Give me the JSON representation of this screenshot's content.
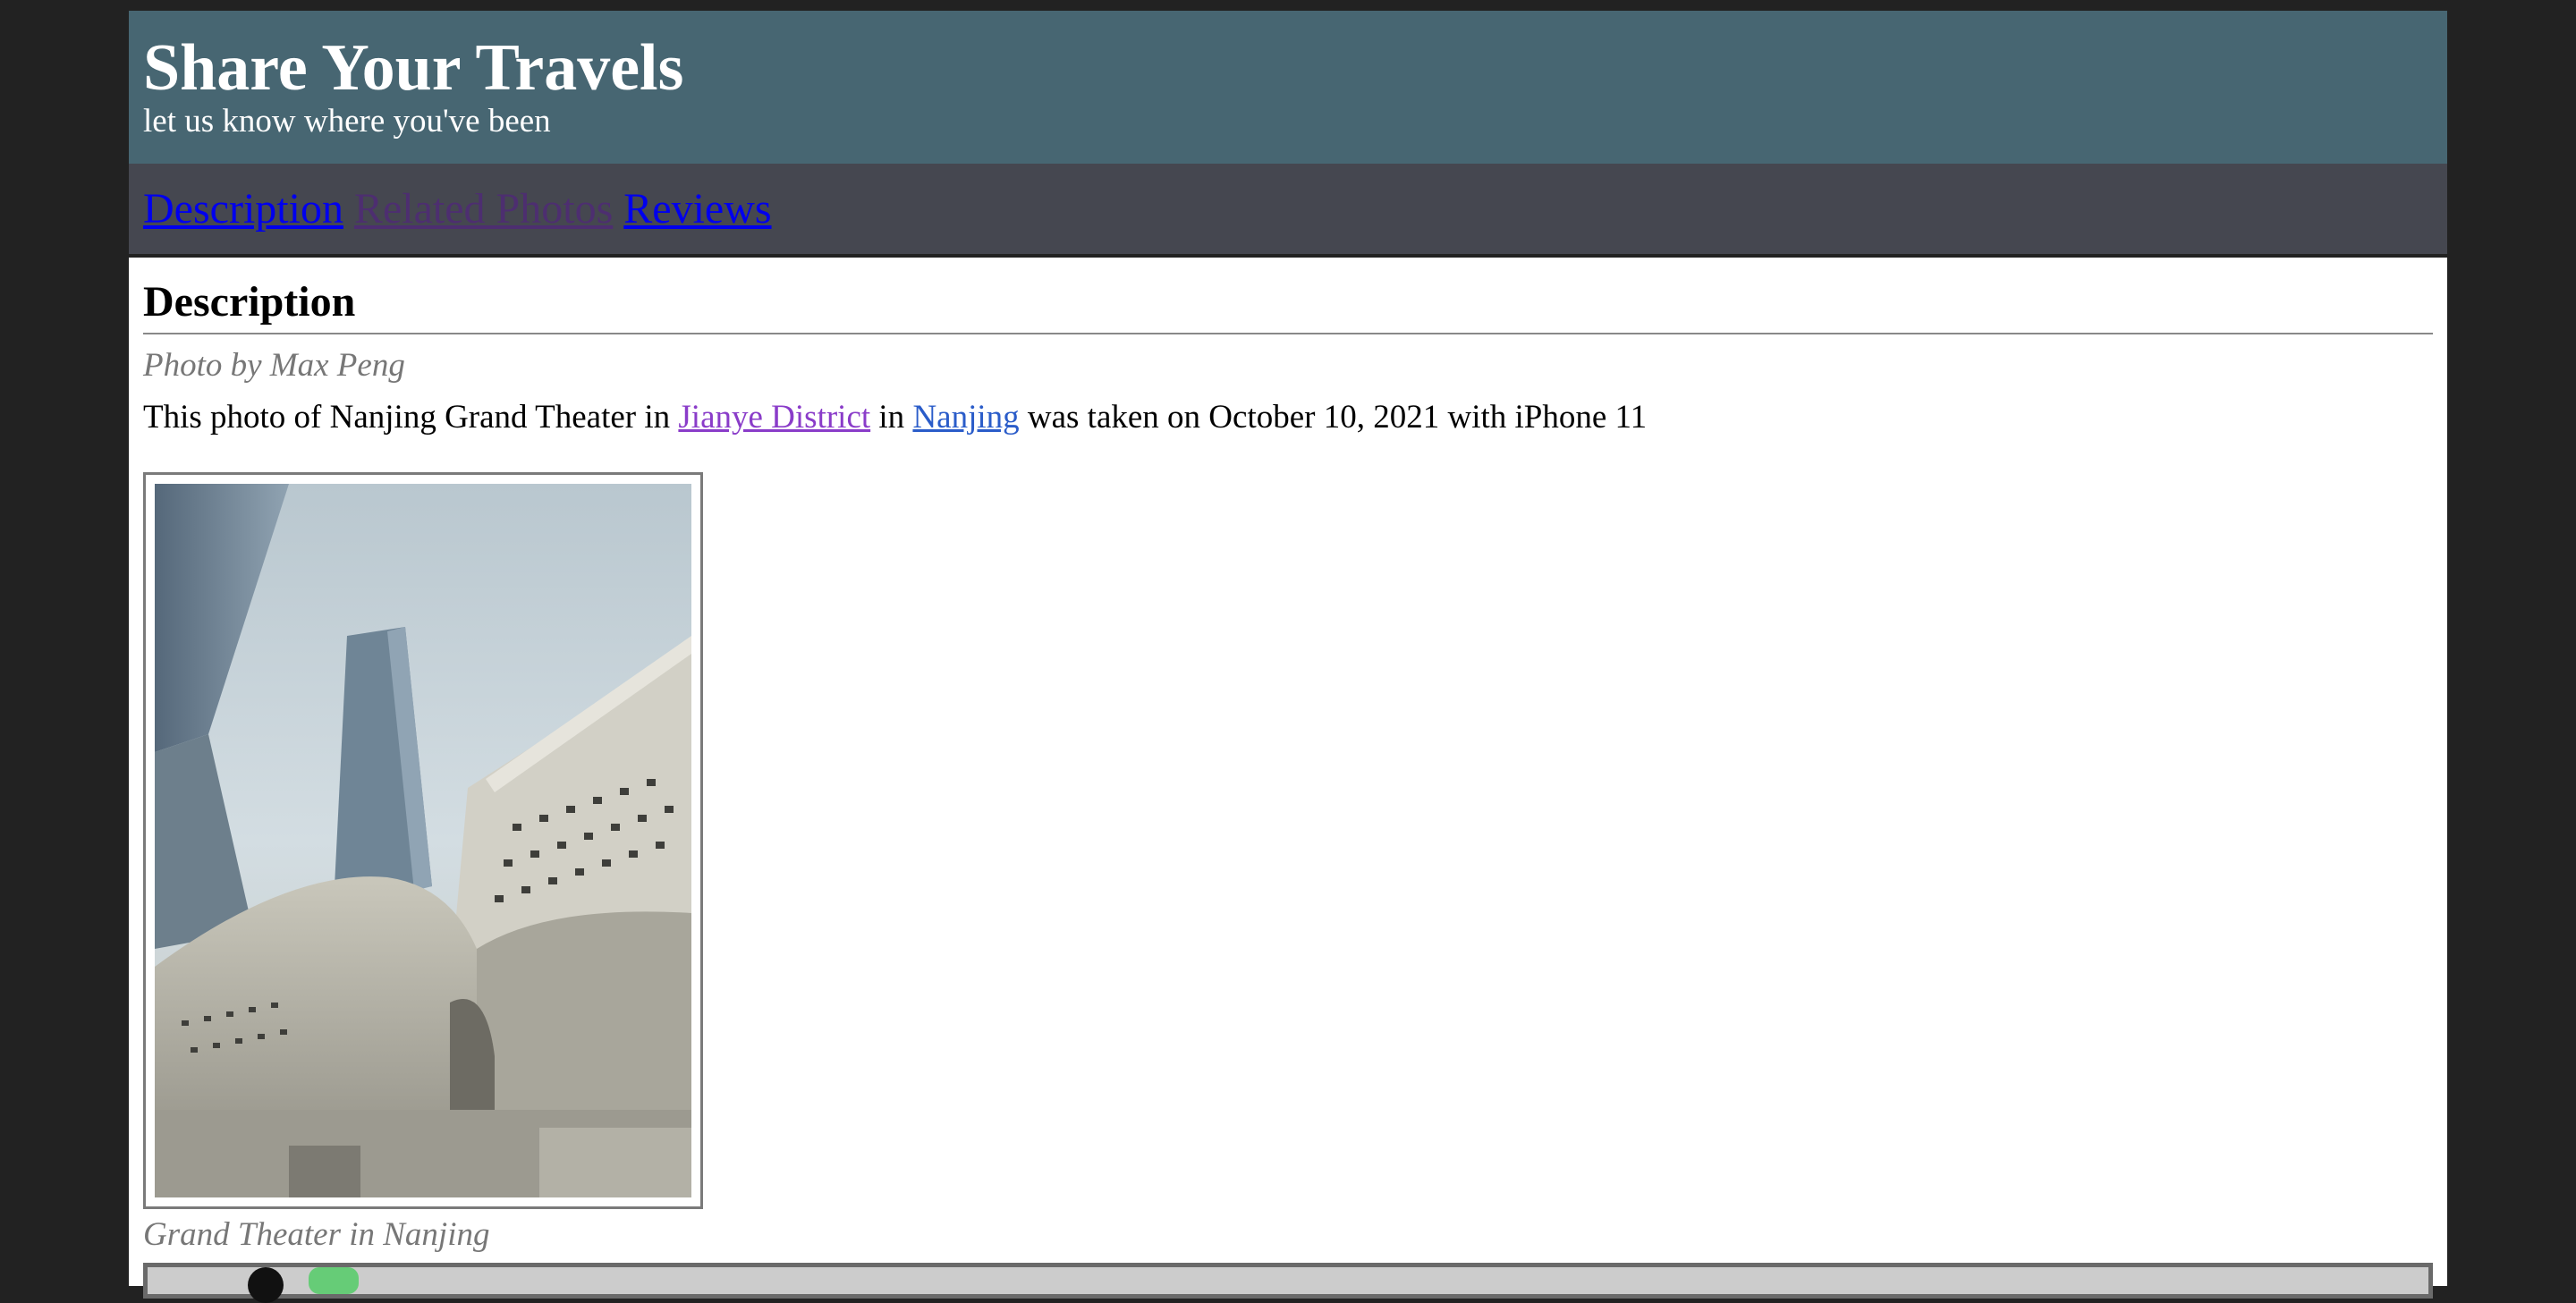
{
  "header": {
    "title": "Share Your Travels",
    "subtitle": "let us know where you've been"
  },
  "nav": {
    "items": [
      {
        "label": "Description"
      },
      {
        "label": "Related Photos"
      },
      {
        "label": "Reviews"
      }
    ]
  },
  "main": {
    "heading": "Description",
    "credit": "Photo by Max Peng",
    "description": {
      "prefix": "This photo of Nanjing Grand Theater in",
      "district_link": "Jianye District",
      "in_word": "in",
      "city_link": "Nanjing",
      "suffix": "was taken on October 10, 2021 with iPhone 11"
    },
    "photo": {
      "icon": "building-photo"
    },
    "caption": "Grand Theater in Nanjing"
  },
  "colors": {
    "header_bg": "#476672",
    "nav_bg": "#454750",
    "page_bg": "#222222"
  }
}
